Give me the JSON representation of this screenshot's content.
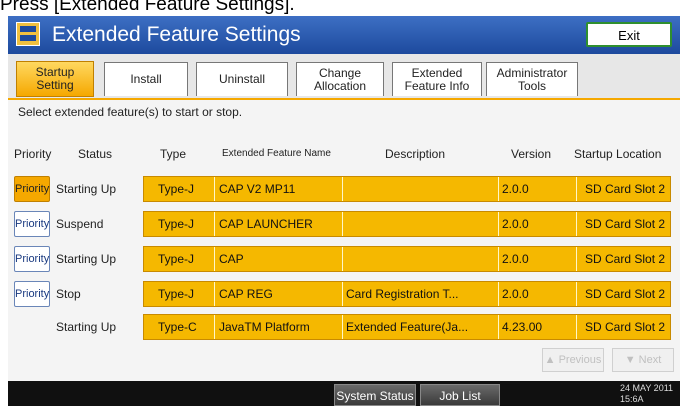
{
  "caption": "Press [Extended Feature Settings].",
  "title": "Extended Feature Settings",
  "exit_label": "Exit",
  "tabs": [
    {
      "label": "Startup\nSetting",
      "active": true
    },
    {
      "label": "Install",
      "active": false
    },
    {
      "label": "Uninstall",
      "active": false
    },
    {
      "label": "Change\nAllocation",
      "active": false
    },
    {
      "label": "Extended\nFeature Info",
      "active": false
    },
    {
      "label": "Administrator\nTools",
      "active": false
    }
  ],
  "instruction": "Select extended feature(s) to start or stop.",
  "columns": {
    "priority": "Priority",
    "status": "Status",
    "type": "Type",
    "name": "Extended Feature Name",
    "description": "Description",
    "version": "Version",
    "location": "Startup Location"
  },
  "rows": [
    {
      "priority": "Priority",
      "status": "Starting Up",
      "type": "Type-J",
      "name": "CAP V2 MP11",
      "description": "",
      "version": "2.0.0",
      "location": "SD Card Slot 2"
    },
    {
      "priority": "Priority",
      "status": "Suspend",
      "type": "Type-J",
      "name": "CAP LAUNCHER",
      "description": "",
      "version": "2.0.0",
      "location": "SD Card Slot 2"
    },
    {
      "priority": "Priority",
      "status": "Starting Up",
      "type": "Type-J",
      "name": "CAP",
      "description": "",
      "version": "2.0.0",
      "location": "SD Card Slot 2"
    },
    {
      "priority": "Priority",
      "status": "Stop",
      "type": "Type-J",
      "name": "CAP REG",
      "description": "Card Registration T...",
      "version": "2.0.0",
      "location": "SD Card Slot 2"
    },
    {
      "priority": "",
      "status": "Starting Up",
      "type": "Type-C",
      "name": "JavaTM Platform",
      "description": "Extended Feature(Ja...",
      "version": "4.23.00",
      "location": "SD Card Slot 2"
    }
  ],
  "pager": {
    "previous": "▲ Previous",
    "next": "▼ Next"
  },
  "bottom": {
    "system_status": "System Status",
    "job_list": "Job List",
    "datetime": "24 MAY  2011\n15:6A"
  }
}
